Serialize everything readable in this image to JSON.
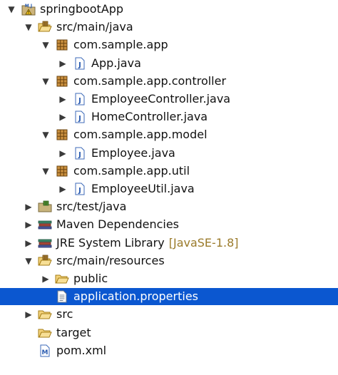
{
  "colors": {
    "selection": "#0b57d0",
    "decoration": "#9a7a2a"
  },
  "tree": [
    {
      "label": "springbootApp",
      "depth": 0,
      "arrow": "expanded",
      "icon": "maven-project-icon",
      "name": "springbootapp"
    },
    {
      "label": "src/main/java",
      "depth": 1,
      "arrow": "expanded",
      "icon": "source-folder-open-icon",
      "name": "src-main-java"
    },
    {
      "label": "com.sample.app",
      "depth": 2,
      "arrow": "expanded",
      "icon": "package-icon",
      "name": "pkg-com-sample-app"
    },
    {
      "label": "App.java",
      "depth": 3,
      "arrow": "collapsed",
      "icon": "java-file-icon",
      "name": "app-java"
    },
    {
      "label": "com.sample.app.controller",
      "depth": 2,
      "arrow": "expanded",
      "icon": "package-icon",
      "name": "pkg-controller"
    },
    {
      "label": "EmployeeController.java",
      "depth": 3,
      "arrow": "collapsed",
      "icon": "java-file-icon",
      "name": "employeecontroller-java"
    },
    {
      "label": "HomeController.java",
      "depth": 3,
      "arrow": "collapsed",
      "icon": "java-file-icon",
      "name": "homecontroller-java"
    },
    {
      "label": "com.sample.app.model",
      "depth": 2,
      "arrow": "expanded",
      "icon": "package-icon",
      "name": "pkg-model"
    },
    {
      "label": "Employee.java",
      "depth": 3,
      "arrow": "collapsed",
      "icon": "java-file-icon",
      "name": "employee-java"
    },
    {
      "label": "com.sample.app.util",
      "depth": 2,
      "arrow": "expanded",
      "icon": "package-icon",
      "name": "pkg-util"
    },
    {
      "label": "EmployeeUtil.java",
      "depth": 3,
      "arrow": "collapsed",
      "icon": "java-file-icon",
      "name": "employeeutil-java"
    },
    {
      "label": "src/test/java",
      "depth": 1,
      "arrow": "collapsed",
      "icon": "source-folder-icon",
      "name": "src-test-java"
    },
    {
      "label": "Maven Dependencies",
      "depth": 1,
      "arrow": "collapsed",
      "icon": "library-icon",
      "name": "maven-dependencies"
    },
    {
      "label": "JRE System Library",
      "decoration": "[JavaSE-1.8]",
      "depth": 1,
      "arrow": "collapsed",
      "icon": "library-icon",
      "name": "jre-system-library"
    },
    {
      "label": "src/main/resources",
      "depth": 1,
      "arrow": "expanded",
      "icon": "source-folder-open-icon",
      "name": "src-main-resources"
    },
    {
      "label": "public",
      "depth": 2,
      "arrow": "collapsed",
      "icon": "folder-open-icon",
      "name": "public-folder"
    },
    {
      "label": "application.properties",
      "depth": 2,
      "arrow": "none",
      "icon": "properties-file-icon",
      "name": "application-properties",
      "selected": true
    },
    {
      "label": "src",
      "depth": 1,
      "arrow": "collapsed",
      "icon": "folder-open-icon",
      "name": "src-folder"
    },
    {
      "label": "target",
      "depth": 1,
      "arrow": "none",
      "icon": "folder-open-icon",
      "name": "target-folder"
    },
    {
      "label": "pom.xml",
      "depth": 1,
      "arrow": "none",
      "icon": "maven-pom-icon",
      "name": "pom-xml"
    }
  ]
}
